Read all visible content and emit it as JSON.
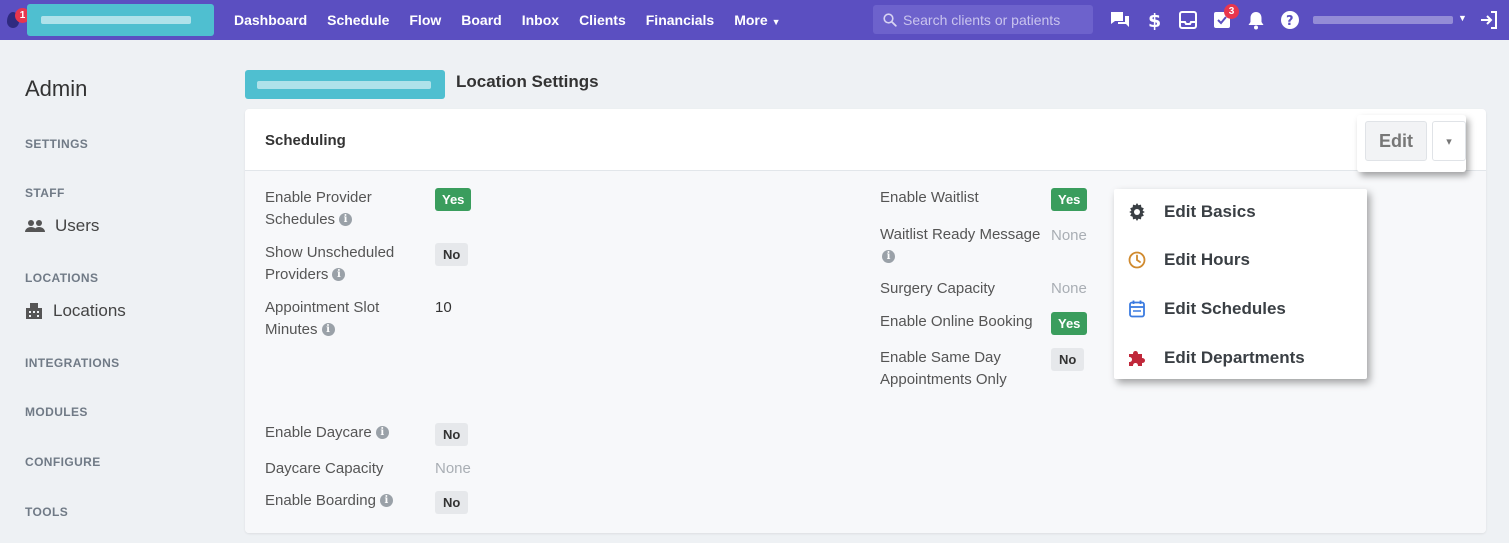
{
  "topbar": {
    "logo_badge": "1",
    "nav": [
      {
        "label": "Dashboard"
      },
      {
        "label": "Schedule"
      },
      {
        "label": "Flow"
      },
      {
        "label": "Board"
      },
      {
        "label": "Inbox"
      },
      {
        "label": "Clients"
      },
      {
        "label": "Financials"
      },
      {
        "label": "More"
      }
    ],
    "search_placeholder": "Search clients or patients",
    "tasks_badge": "3",
    "icons": [
      "chat-icon",
      "dollar-icon",
      "inbox-tray-icon",
      "tasks-icon",
      "bell-icon",
      "help-icon",
      "logout-icon"
    ]
  },
  "sidebar": {
    "title": "Admin",
    "sections": {
      "settings": "SETTINGS",
      "staff": "STAFF",
      "locations": "LOCATIONS",
      "integrations": "INTEGRATIONS",
      "modules": "MODULES",
      "configure": "CONFIGURE",
      "tools": "TOOLS"
    },
    "links": {
      "users": "Users",
      "locations": "Locations"
    }
  },
  "page": {
    "title": "Location Settings"
  },
  "card": {
    "title": "Scheduling",
    "left": {
      "enable_provider_schedules": {
        "label_l1": "Enable Provider",
        "label_l2": "Schedules",
        "value": "Yes"
      },
      "show_unscheduled_providers": {
        "label_l1": "Show Unscheduled",
        "label_l2": "Providers",
        "value": "No"
      },
      "appointment_slot_minutes": {
        "label_l1": "Appointment Slot",
        "label_l2": "Minutes",
        "value": "10"
      },
      "enable_daycare": {
        "label": "Enable Daycare",
        "value": "No"
      },
      "daycare_capacity": {
        "label": "Daycare Capacity",
        "value": "None"
      },
      "enable_boarding": {
        "label": "Enable Boarding",
        "value": "No"
      }
    },
    "right": {
      "enable_waitlist": {
        "label": "Enable Waitlist",
        "value": "Yes"
      },
      "waitlist_ready_message": {
        "label": "Waitlist Ready Message",
        "value": "None"
      },
      "surgery_capacity": {
        "label": "Surgery Capacity",
        "value": "None"
      },
      "enable_online_booking": {
        "label": "Enable Online Booking",
        "value": "Yes"
      },
      "enable_same_day": {
        "label_l1": "Enable Same Day",
        "label_l2": "Appointments Only",
        "value": "No"
      }
    },
    "info_glyph": "i"
  },
  "edit": {
    "label": "Edit",
    "caret": "▾"
  },
  "dropdown": {
    "items": [
      {
        "label": "Edit Basics",
        "icon": "gear-icon",
        "color": "#3a3f44"
      },
      {
        "label": "Edit Hours",
        "icon": "clock-icon",
        "color": "#d08a2e"
      },
      {
        "label": "Edit Schedules",
        "icon": "calendar-icon",
        "color": "#3b7be0"
      },
      {
        "label": "Edit Departments",
        "icon": "puzzle-icon",
        "color": "#c0283a"
      }
    ]
  }
}
